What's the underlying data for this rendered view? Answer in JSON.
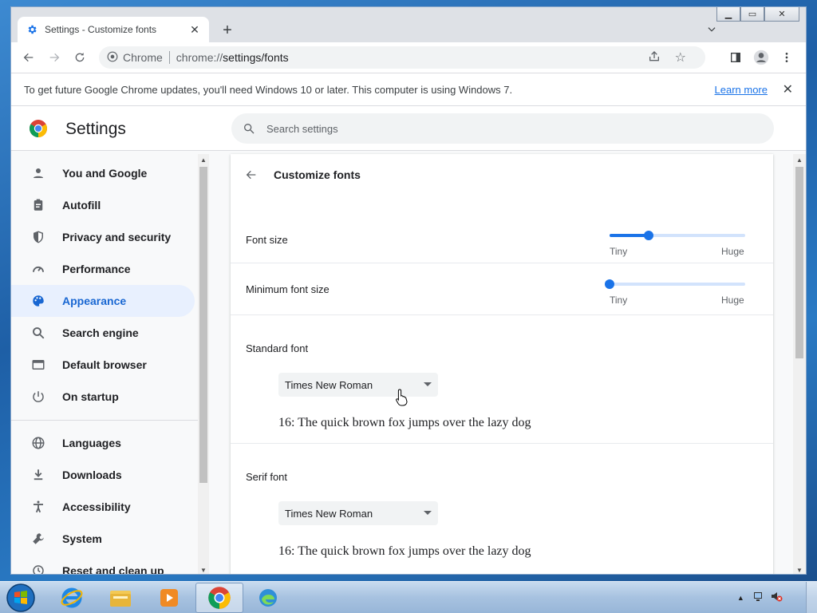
{
  "window": {
    "tab_title": "Settings - Customize fonts",
    "new_tab": "+"
  },
  "toolbar": {
    "site_label": "Chrome",
    "url_prefix": "chrome://",
    "url_main": "settings/fonts"
  },
  "infobar": {
    "message": "To get future Google Chrome updates, you'll need Windows 10 or later. This computer is using Windows 7.",
    "learn_more": "Learn more"
  },
  "settings": {
    "title": "Settings",
    "search_placeholder": "Search settings"
  },
  "sidebar": {
    "items": [
      {
        "label": "You and Google",
        "icon": "person-icon"
      },
      {
        "label": "Autofill",
        "icon": "clipboard-icon"
      },
      {
        "label": "Privacy and security",
        "icon": "shield-icon"
      },
      {
        "label": "Performance",
        "icon": "speedometer-icon"
      },
      {
        "label": "Appearance",
        "icon": "palette-icon",
        "active": true
      },
      {
        "label": "Search engine",
        "icon": "search-icon"
      },
      {
        "label": "Default browser",
        "icon": "browser-icon"
      },
      {
        "label": "On startup",
        "icon": "power-icon"
      },
      {
        "label": "Languages",
        "icon": "globe-icon"
      },
      {
        "label": "Downloads",
        "icon": "download-icon"
      },
      {
        "label": "Accessibility",
        "icon": "accessibility-icon"
      },
      {
        "label": "System",
        "icon": "wrench-icon"
      },
      {
        "label": "Reset and clean up",
        "icon": "reset-icon"
      }
    ]
  },
  "main": {
    "heading": "Customize fonts",
    "font_size": {
      "label": "Font size",
      "min_label": "Tiny",
      "max_label": "Huge",
      "level": 0.29
    },
    "min_font_size": {
      "label": "Minimum font size",
      "min_label": "Tiny",
      "max_label": "Huge",
      "level": 0.0
    },
    "standard_font": {
      "label": "Standard font",
      "value": "Times New Roman",
      "sample": "16: The quick brown fox jumps over the lazy dog"
    },
    "serif_font": {
      "label": "Serif font",
      "value": "Times New Roman",
      "sample": "16: The quick brown fox jumps over the lazy dog"
    }
  },
  "colors": {
    "accent": "#1a73e8",
    "active_nav_bg": "#e8f0fe"
  }
}
